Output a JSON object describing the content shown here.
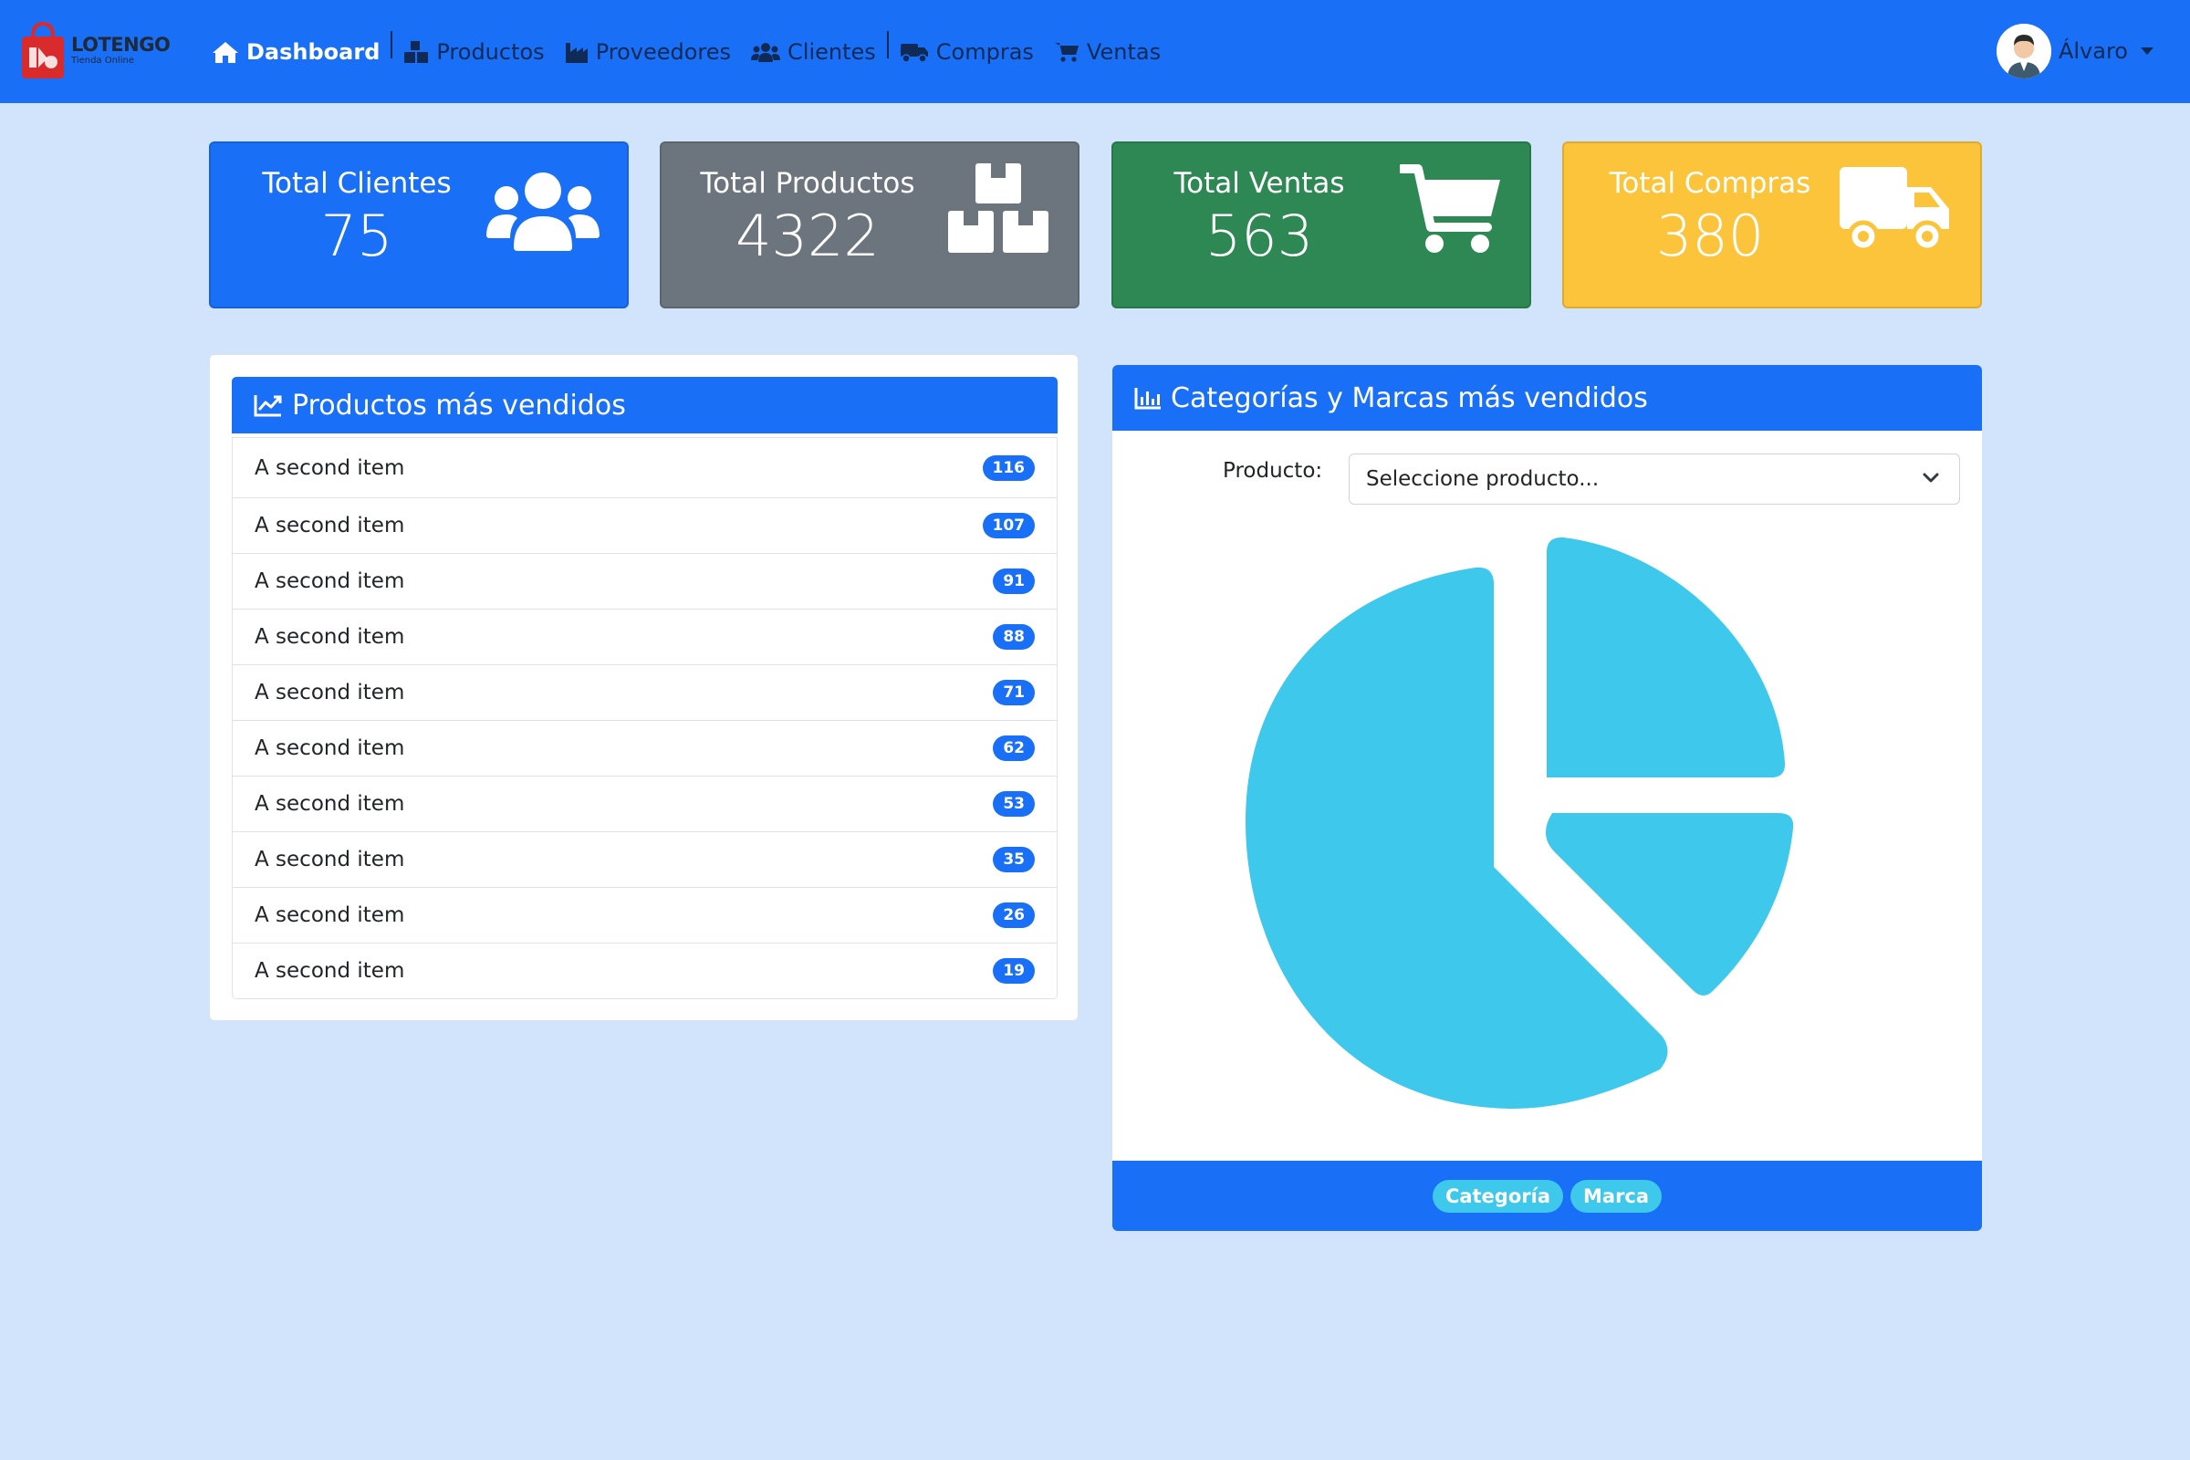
{
  "brand": {
    "name": "LOTENGO",
    "subtitle": "Tienda Online"
  },
  "nav": {
    "items": [
      {
        "label": "Dashboard",
        "icon": "home-icon",
        "active": true
      },
      {
        "label": "Productos",
        "icon": "boxes-icon"
      },
      {
        "label": "Proveedores",
        "icon": "industry-icon"
      },
      {
        "label": "Clientes",
        "icon": "users-icon"
      },
      {
        "label": "Compras",
        "icon": "truck-icon"
      },
      {
        "label": "Ventas",
        "icon": "cart-icon"
      }
    ],
    "user": "Álvaro"
  },
  "stats": [
    {
      "title": "Total Clientes",
      "value": "75",
      "color": "#1a6ff7",
      "icon": "users-icon"
    },
    {
      "title": "Total Productos",
      "value": "4322",
      "color": "#6c757d",
      "icon": "boxes-icon"
    },
    {
      "title": "Total Ventas",
      "value": "563",
      "color": "#2e8854",
      "icon": "cart-icon"
    },
    {
      "title": "Total Compras",
      "value": "380",
      "color": "#fbc43a",
      "icon": "truck-icon"
    }
  ],
  "top_products": {
    "title": "Productos más vendidos",
    "items": [
      {
        "label": "A second item",
        "count": "116"
      },
      {
        "label": "A second item",
        "count": "107"
      },
      {
        "label": "A second item",
        "count": "91"
      },
      {
        "label": "A second item",
        "count": "88"
      },
      {
        "label": "A second item",
        "count": "71"
      },
      {
        "label": "A second item",
        "count": "62"
      },
      {
        "label": "A second item",
        "count": "53"
      },
      {
        "label": "A second item",
        "count": "35"
      },
      {
        "label": "A second item",
        "count": "26"
      },
      {
        "label": "A second item",
        "count": "19"
      }
    ]
  },
  "categories": {
    "title": "Categorías y Marcas más vendidos",
    "field_label": "Producto:",
    "select_value": "Seleccione producto...",
    "pie_color": "#3dc8ec",
    "footer": [
      "Categoría",
      "Marca"
    ]
  },
  "colors": {
    "primary": "#1a6ff7",
    "background": "#d2e3fc",
    "accent": "#3dc8ec"
  }
}
